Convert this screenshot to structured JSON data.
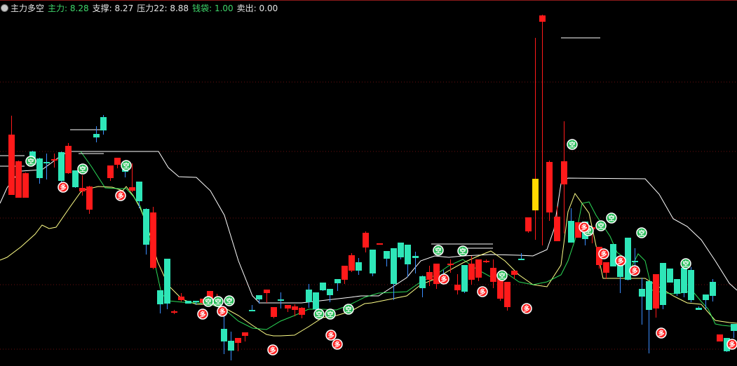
{
  "header": {
    "indicator_name": "主力多空",
    "items": [
      {
        "label": "主力",
        "value": "8.28",
        "color": "#3fd66b"
      },
      {
        "label": "支撑",
        "value": "8.27",
        "color": "#e6e6e6"
      },
      {
        "label": "压力22",
        "value": "8.88",
        "color": "#e6e6e6"
      },
      {
        "label": "钱袋",
        "value": "1.00",
        "color": "#3fd66b"
      },
      {
        "label": "卖出",
        "value": "0.00",
        "color": "#e6e6e6"
      }
    ]
  },
  "colors": {
    "background": "#000000",
    "up_candle": "#ff1a1a",
    "down_candle": "#2ee6b8",
    "wick_down": "#3a8cff",
    "special_candle": "#ffd800",
    "support_line": "#ffff88",
    "pressure_line": "#ffffff",
    "zhuli_line": "#33ff66",
    "grid": "#6a0f0f",
    "marker_buy": "#ff2020",
    "marker_sell": "#22bb55"
  },
  "chart_data": {
    "type": "candlestick",
    "y_range": [
      0,
      522
    ],
    "note_units": "vertical scale unlabeled; values given in chart units (higher = higher price)",
    "candles": [
      [
        244,
        330,
        318,
        357
      ],
      [
        240,
        292,
        293,
        291
      ],
      [
        240,
        275,
        265,
        276
      ],
      [
        306,
        287,
        286,
        307
      ],
      [
        296,
        268,
        260,
        297
      ],
      [
        291,
        289,
        303,
        266
      ],
      [
        294,
        295,
        303,
        283
      ],
      [
        305,
        264,
        262,
        306
      ],
      [
        275,
        314,
        318,
        274
      ],
      [
        279,
        255,
        254,
        276
      ],
      [
        249,
        254,
        272,
        243
      ],
      [
        223,
        256,
        257,
        217
      ],
      [
        331,
        326,
        342,
        319
      ],
      [
        355,
        336,
        358,
        330
      ],
      [
        268,
        286,
        284,
        264
      ],
      [
        287,
        297,
        297,
        282
      ],
      [
        287,
        277,
        288,
        269
      ],
      [
        250,
        255,
        289,
        248
      ],
      [
        263,
        235,
        260,
        225
      ],
      [
        224,
        173,
        225,
        159
      ],
      [
        140,
        219,
        227,
        138
      ],
      [
        108,
        88,
        106,
        75
      ],
      [
        153,
        89,
        144,
        81
      ],
      [
        77,
        78,
        80,
        74
      ],
      [
        94,
        99,
        92,
        104
      ],
      [
        93,
        89,
        89,
        89
      ],
      [
        93,
        91,
        93,
        87
      ],
      [
        90,
        96,
        94,
        88
      ],
      [
        94,
        107,
        93,
        107
      ],
      [
        87,
        93,
        103,
        85
      ],
      [
        53,
        35,
        75,
        17
      ],
      [
        36,
        22,
        49,
        8
      ],
      [
        33,
        40,
        40,
        21
      ],
      [
        43,
        48,
        45,
        35
      ],
      [
        80,
        79,
        87,
        80
      ],
      [
        101,
        95,
        100,
        89
      ],
      [
        104,
        109,
        90,
        103
      ],
      [
        70,
        84,
        80,
        68
      ],
      [
        95,
        93,
        105,
        82
      ],
      [
        82,
        87,
        84,
        77
      ],
      [
        80,
        85,
        88,
        71
      ],
      [
        73,
        83,
        84,
        68
      ],
      [
        109,
        91,
        117,
        83
      ],
      [
        105,
        81,
        101,
        76
      ],
      [
        119,
        108,
        115,
        107
      ],
      [
        110,
        101,
        107,
        91
      ],
      [
        124,
        118,
        123,
        107
      ],
      [
        123,
        143,
        142,
        117
      ],
      [
        136,
        158,
        161,
        134
      ],
      [
        148,
        136,
        154,
        130
      ],
      [
        169,
        190,
        192,
        162
      ],
      [
        166,
        132,
        166,
        128
      ],
      [
        174,
        175,
        175,
        175
      ],
      [
        164,
        153,
        163,
        142
      ],
      [
        168,
        117,
        143,
        94
      ],
      [
        176,
        155,
        175,
        152
      ],
      [
        173,
        145,
        153,
        127
      ],
      [
        157,
        154,
        163,
        132
      ],
      [
        128,
        111,
        129,
        98
      ],
      [
        123,
        134,
        143,
        114
      ],
      [
        117,
        146,
        143,
        110
      ],
      [
        129,
        127,
        137,
        123
      ],
      [
        145,
        146,
        152,
        133
      ],
      [
        108,
        116,
        131,
        102
      ],
      [
        144,
        106,
        134,
        104
      ],
      [
        123,
        146,
        157,
        116
      ],
      [
        126,
        152,
        149,
        121
      ],
      [
        149,
        150,
        152,
        147
      ],
      [
        120,
        140,
        152,
        111
      ],
      [
        96,
        129,
        127,
        93
      ],
      [
        84,
        120,
        108,
        79
      ],
      [
        130,
        136,
        136,
        124
      ],
      [
        153,
        152,
        161,
        154
      ],
      [
        192,
        212,
        211,
        190
      ],
      [
        222,
        267,
        468,
        180
      ],
      [
        491,
        500,
        501,
        172
      ],
      [
        219,
        291,
        293,
        207
      ],
      [
        178,
        213,
        228,
        186
      ],
      [
        259,
        292,
        349,
        189
      ],
      [
        207,
        176,
        225,
        180
      ],
      [
        183,
        205,
        204,
        189
      ],
      [
        206,
        181,
        172,
        180
      ],
      [
        195,
        198,
        188,
        175
      ],
      [
        144,
        170,
        165,
        139
      ],
      [
        133,
        148,
        140,
        124
      ],
      [
        174,
        142,
        171,
        143
      ],
      [
        150,
        127,
        152,
        104
      ],
      [
        183,
        123,
        148,
        122
      ],
      [
        150,
        149,
        168,
        131
      ],
      [
        110,
        99,
        126,
        59
      ],
      [
        121,
        80,
        119,
        18
      ],
      [
        82,
        131,
        126,
        69
      ],
      [
        147,
        87,
        139,
        81
      ],
      [
        139,
        119,
        131,
        124
      ],
      [
        124,
        103,
        118,
        100
      ],
      [
        140,
        104,
        139,
        98
      ],
      [
        137,
        94,
        141,
        91
      ],
      [
        83,
        80,
        85,
        81
      ],
      [
        102,
        94,
        96,
        81
      ],
      [
        120,
        100,
        124,
        92
      ],
      [
        35,
        45,
        36,
        36
      ],
      [
        40,
        21,
        23,
        20
      ],
      [
        60,
        50,
        50,
        40
      ]
    ],
    "support": [
      [
        0,
        151
      ],
      [
        10,
        155
      ],
      [
        30,
        170
      ],
      [
        50,
        188
      ],
      [
        60,
        201
      ],
      [
        70,
        196
      ],
      [
        80,
        198
      ],
      [
        100,
        227
      ],
      [
        115,
        248
      ],
      [
        120,
        251
      ],
      [
        140,
        256
      ],
      [
        160,
        255
      ],
      [
        175,
        250
      ],
      [
        180,
        256
      ],
      [
        190,
        243
      ],
      [
        200,
        225
      ],
      [
        210,
        200
      ],
      [
        225,
        148
      ],
      [
        240,
        115
      ],
      [
        260,
        95
      ],
      [
        280,
        88
      ],
      [
        300,
        88
      ],
      [
        320,
        83
      ],
      [
        340,
        72
      ],
      [
        360,
        58
      ],
      [
        380,
        45
      ],
      [
        390,
        43
      ],
      [
        400,
        43
      ],
      [
        420,
        44
      ],
      [
        440,
        56
      ],
      [
        460,
        69
      ],
      [
        480,
        72
      ],
      [
        500,
        78
      ],
      [
        520,
        89
      ],
      [
        530,
        90
      ],
      [
        540,
        92
      ],
      [
        560,
        96
      ],
      [
        580,
        100
      ],
      [
        600,
        116
      ],
      [
        620,
        124
      ],
      [
        630,
        130
      ],
      [
        640,
        136
      ],
      [
        660,
        147
      ],
      [
        680,
        156
      ],
      [
        700,
        164
      ],
      [
        720,
        150
      ],
      [
        740,
        130
      ],
      [
        760,
        116
      ],
      [
        780,
        113
      ],
      [
        800,
        144
      ],
      [
        810,
        220
      ],
      [
        820,
        246
      ],
      [
        840,
        218
      ],
      [
        860,
        125
      ],
      [
        880,
        125
      ],
      [
        920,
        125
      ],
      [
        960,
        100
      ],
      [
        970,
        95
      ],
      [
        980,
        90
      ],
      [
        1000,
        88
      ],
      [
        1020,
        65
      ],
      [
        1040,
        62
      ],
      [
        1051,
        61
      ]
    ],
    "pressure": [
      [
        0,
        232
      ],
      [
        10,
        254
      ],
      [
        20,
        268
      ],
      [
        30,
        278
      ],
      [
        60,
        280
      ],
      [
        90,
        302
      ],
      [
        100,
        306
      ],
      [
        120,
        306
      ],
      [
        226,
        306
      ],
      [
        240,
        283
      ],
      [
        255,
        270
      ],
      [
        280,
        269
      ],
      [
        300,
        250
      ],
      [
        320,
        215
      ],
      [
        340,
        150
      ],
      [
        360,
        100
      ],
      [
        370,
        90
      ],
      [
        430,
        90
      ],
      [
        500,
        98
      ],
      [
        515,
        100
      ],
      [
        540,
        100
      ],
      [
        580,
        126
      ],
      [
        600,
        150
      ],
      [
        620,
        157
      ],
      [
        640,
        155
      ],
      [
        660,
        157
      ],
      [
        700,
        159
      ],
      [
        740,
        158
      ],
      [
        760,
        157
      ],
      [
        780,
        166
      ],
      [
        790,
        195
      ],
      [
        800,
        260
      ],
      [
        810,
        268
      ],
      [
        920,
        267
      ],
      [
        940,
        245
      ],
      [
        960,
        210
      ],
      [
        980,
        199
      ],
      [
        1000,
        180
      ],
      [
        1020,
        150
      ],
      [
        1040,
        118
      ],
      [
        1051,
        108
      ]
    ],
    "zhuli": [
      [
        115,
        306
      ],
      [
        130,
        285
      ],
      [
        150,
        254
      ],
      [
        170,
        253
      ],
      [
        180,
        253
      ],
      [
        190,
        242
      ],
      [
        200,
        228
      ],
      [
        210,
        198
      ],
      [
        220,
        150
      ],
      [
        230,
        104
      ],
      [
        240,
        93
      ],
      [
        260,
        91
      ],
      [
        280,
        90
      ],
      [
        300,
        88
      ],
      [
        320,
        81
      ],
      [
        340,
        64
      ],
      [
        360,
        54
      ],
      [
        380,
        52
      ],
      [
        400,
        64
      ],
      [
        420,
        72
      ],
      [
        440,
        81
      ],
      [
        460,
        81
      ],
      [
        480,
        80
      ],
      [
        500,
        88
      ],
      [
        520,
        98
      ],
      [
        540,
        104
      ],
      [
        560,
        105
      ],
      [
        580,
        106
      ],
      [
        600,
        120
      ],
      [
        620,
        129
      ],
      [
        640,
        143
      ],
      [
        660,
        152
      ],
      [
        680,
        138
      ],
      [
        700,
        127
      ],
      [
        720,
        134
      ],
      [
        740,
        120
      ],
      [
        760,
        116
      ],
      [
        780,
        120
      ],
      [
        800,
        130
      ],
      [
        810,
        150
      ],
      [
        820,
        180
      ],
      [
        830,
        232
      ],
      [
        840,
        234
      ],
      [
        850,
        215
      ],
      [
        860,
        200
      ],
      [
        870,
        185
      ],
      [
        880,
        162
      ],
      [
        890,
        155
      ],
      [
        900,
        140
      ],
      [
        910,
        160
      ],
      [
        920,
        150
      ],
      [
        930,
        108
      ],
      [
        940,
        106
      ],
      [
        950,
        104
      ],
      [
        960,
        103
      ],
      [
        970,
        104
      ],
      [
        980,
        106
      ],
      [
        990,
        104
      ],
      [
        1000,
        92
      ],
      [
        1010,
        81
      ],
      [
        1020,
        60
      ],
      [
        1030,
        58
      ],
      [
        1040,
        57
      ],
      [
        1051,
        57
      ]
    ],
    "short_flat_lines": [
      [
        0,
        300,
        35
      ],
      [
        0,
        285,
        35
      ],
      [
        100,
        337,
        148
      ],
      [
        112,
        303,
        148
      ],
      [
        615,
        174,
        703
      ],
      [
        655,
        168,
        703
      ],
      [
        800,
        468,
        856
      ]
    ],
    "markers": [
      {
        "text": "空",
        "type": "sell",
        "points": [
          [
            44,
            292
          ],
          [
            118,
            281
          ],
          [
            180,
            286
          ],
          [
            297,
            92
          ],
          [
            311,
            92
          ],
          [
            327,
            93
          ],
          [
            455,
            74
          ],
          [
            471,
            74
          ],
          [
            497,
            81
          ],
          [
            625,
            165
          ],
          [
            660,
            164
          ],
          [
            716,
            129
          ],
          [
            816,
            316
          ],
          [
            872,
            211
          ],
          [
            839,
            193
          ],
          [
            857,
            200
          ],
          [
            915,
            190
          ],
          [
            978,
            146
          ]
        ]
      },
      {
        "text": "多",
        "type": "buy",
        "points": [
          [
            90,
            255
          ],
          [
            172,
            243
          ],
          [
            289,
            74
          ],
          [
            317,
            78
          ],
          [
            389,
            23
          ],
          [
            472,
            44
          ],
          [
            481,
            31
          ],
          [
            633,
            124
          ],
          [
            688,
            106
          ],
          [
            751,
            82
          ],
          [
            833,
            198
          ],
          [
            861,
            160
          ],
          [
            885,
            150
          ],
          [
            905,
            136
          ],
          [
            943,
            47
          ],
          [
            1044,
            31
          ]
        ]
      }
    ],
    "grid_y": [
      24,
      116,
      211,
      306,
      405
    ]
  }
}
